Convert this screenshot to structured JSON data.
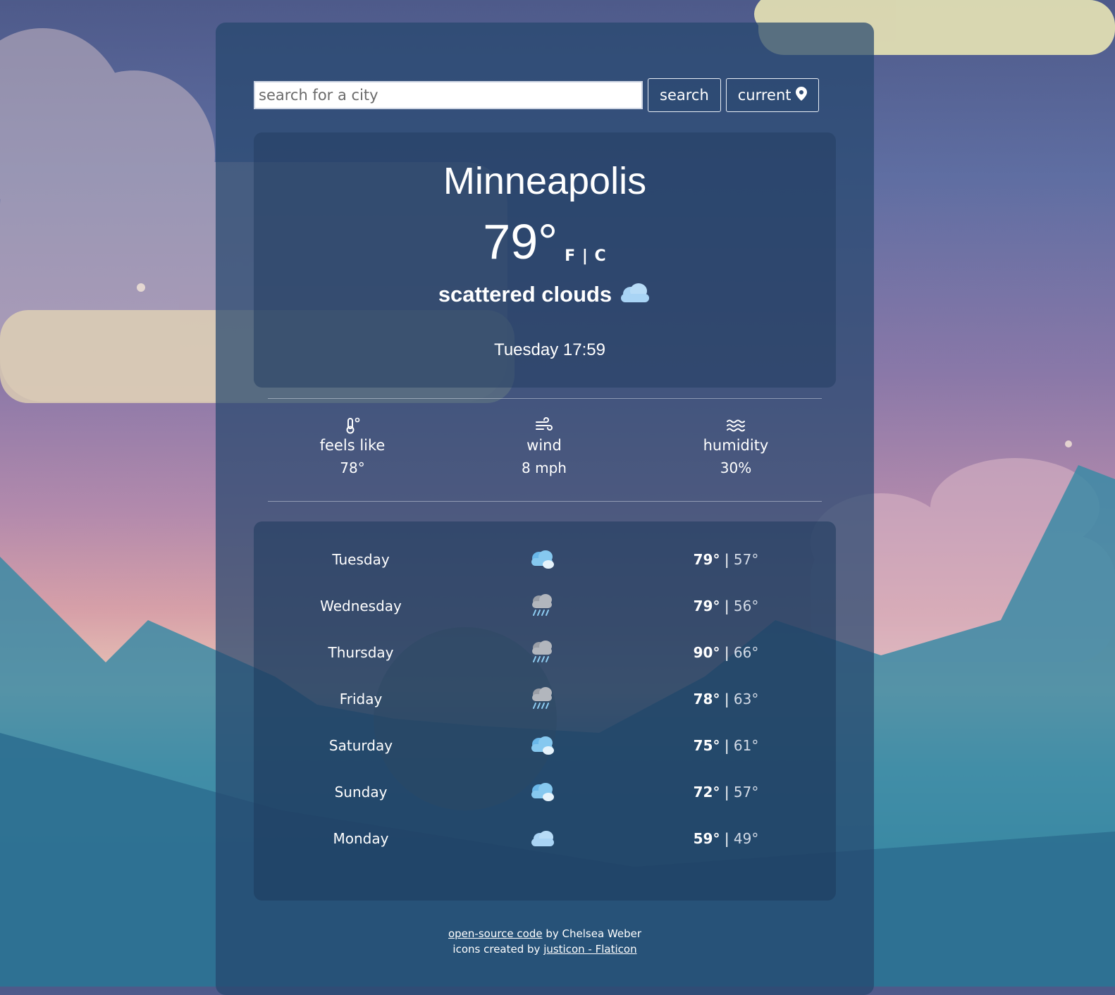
{
  "search": {
    "placeholder": "search for a city",
    "button_label": "search",
    "current_label": "current"
  },
  "current": {
    "city": "Minneapolis",
    "temperature": "79°",
    "units": "F | C",
    "description": "scattered clouds",
    "datetime": "Tuesday 17:59"
  },
  "stats": [
    {
      "label": "feels like",
      "value": "78°",
      "icon": "thermometer-icon"
    },
    {
      "label": "wind",
      "value": "8 mph",
      "icon": "wind-icon"
    },
    {
      "label": "humidity",
      "value": "30%",
      "icon": "humidity-icon"
    }
  ],
  "forecast": [
    {
      "day": "Tuesday",
      "hi": "79°",
      "lo": "57°",
      "icon": "cloudy"
    },
    {
      "day": "Wednesday",
      "hi": "79°",
      "lo": "56°",
      "icon": "rain"
    },
    {
      "day": "Thursday",
      "hi": "90°",
      "lo": "66°",
      "icon": "rain"
    },
    {
      "day": "Friday",
      "hi": "78°",
      "lo": "63°",
      "icon": "rain"
    },
    {
      "day": "Saturday",
      "hi": "75°",
      "lo": "61°",
      "icon": "cloudy"
    },
    {
      "day": "Sunday",
      "hi": "72°",
      "lo": "57°",
      "icon": "cloudy"
    },
    {
      "day": "Monday",
      "hi": "59°",
      "lo": "49°",
      "icon": "cloud"
    }
  ],
  "footer": {
    "code_link": "open-source code",
    "by_text": " by Chelsea Weber",
    "icons_text": "icons created by ",
    "icons_link": "justicon - Flaticon"
  },
  "colors": {
    "panel": "#26466e",
    "accent": "#ffffff",
    "cloud_icon": "#a9d4f5"
  }
}
